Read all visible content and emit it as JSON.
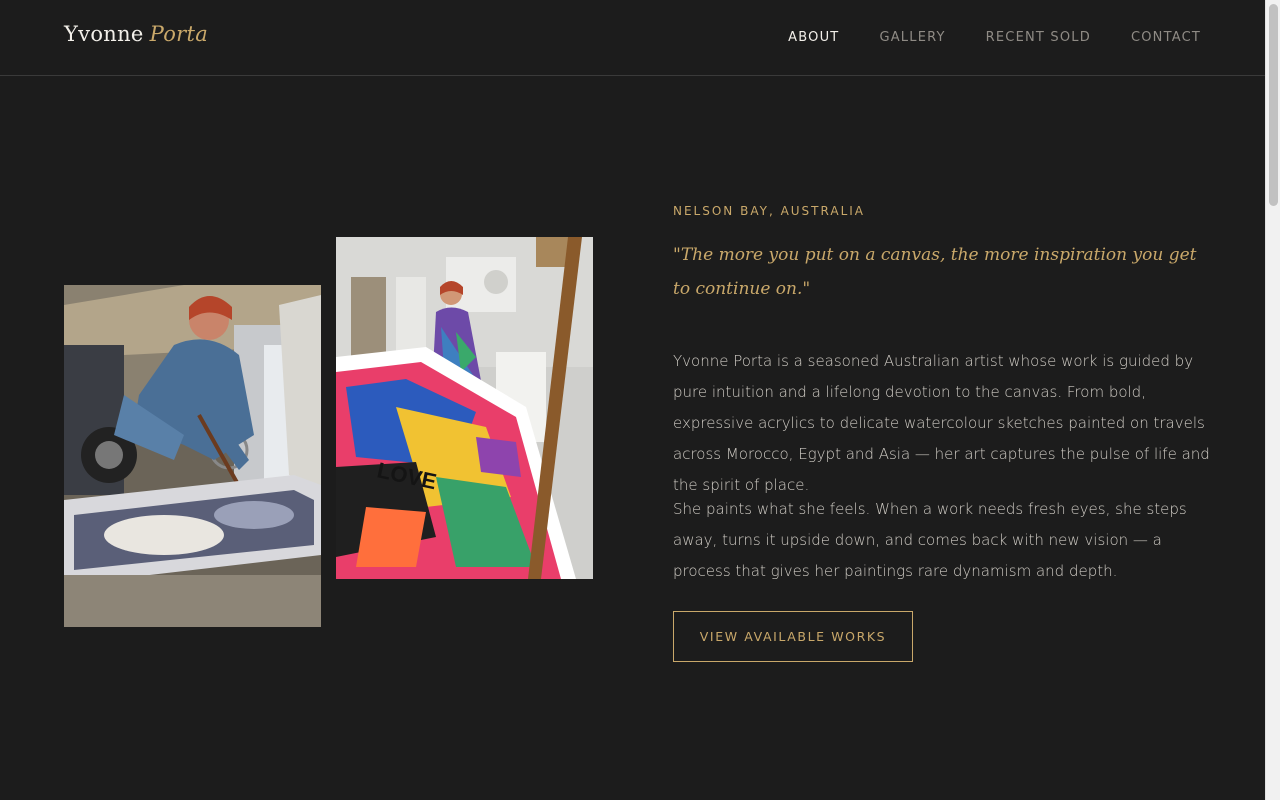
{
  "brand": {
    "first_name": "Yvonne",
    "last_name": "Porta"
  },
  "nav": {
    "items": [
      {
        "label": "ABOUT",
        "active": true
      },
      {
        "label": "GALLERY",
        "active": false
      },
      {
        "label": "RECENT SOLD",
        "active": false
      },
      {
        "label": "CONTACT",
        "active": false
      }
    ]
  },
  "about": {
    "location": "NELSON BAY, AUSTRALIA",
    "quote": "\"The more you put on a canvas, the more inspiration you get to continue on.\"",
    "paragraphs": [
      "Yvonne Porta is a seasoned Australian artist whose work is guided by pure intuition and a lifelong devotion to the canvas. From bold, expressive acrylics to delicate watercolour sketches painted on travels across Morocco, Egypt and Asia — her art captures the pulse of life and the spirit of place.",
      "She paints what she feels. When a work needs fresh eyes, she steps away, turns it upside down, and comes back with new vision — a process that gives her paintings rare dynamism and depth."
    ],
    "cta_label": "VIEW AVAILABLE WORKS"
  },
  "colors": {
    "background": "#1c1c1c",
    "accent": "#c9a86a",
    "text": "#cfcbc4"
  }
}
